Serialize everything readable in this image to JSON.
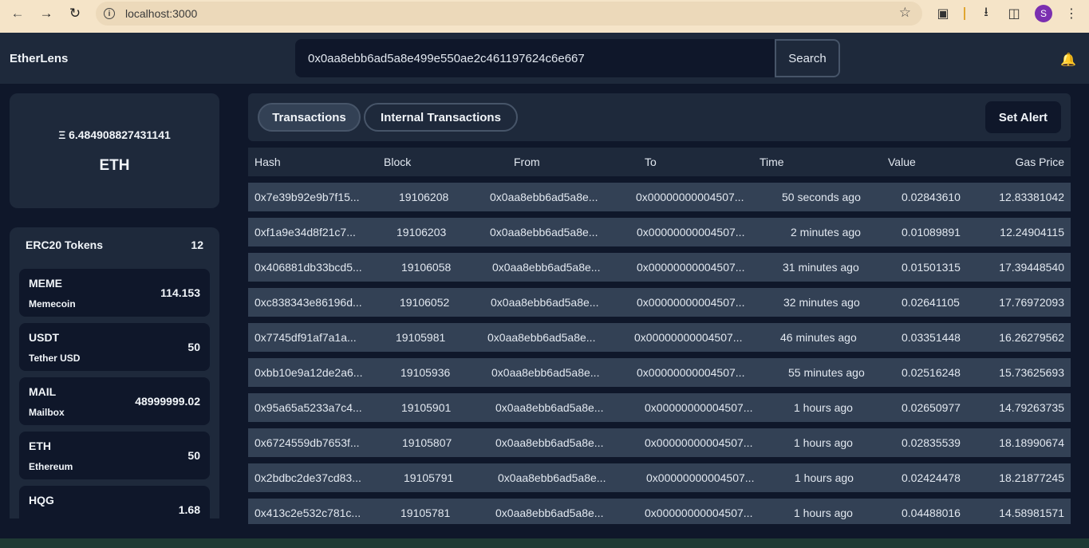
{
  "browser": {
    "url": "localhost:3000",
    "profile_initial": "S"
  },
  "header": {
    "brand": "EtherLens",
    "search_value": "0x0aa8ebb6ad5a8e499e550ae2c461197624c6e667",
    "search_button": "Search"
  },
  "balance": {
    "value": "Ξ 6.484908827431141",
    "unit": "ETH"
  },
  "tokens": {
    "title": "ERC20 Tokens",
    "count": "12",
    "items": [
      {
        "symbol": "MEME",
        "name": "Memecoin",
        "balance": "114.153"
      },
      {
        "symbol": "USDT",
        "name": "Tether USD",
        "balance": "50"
      },
      {
        "symbol": "MAIL",
        "name": "Mailbox",
        "balance": "48999999.02"
      },
      {
        "symbol": "ETH",
        "name": "Ethereum",
        "balance": "50"
      },
      {
        "symbol": "HQG",
        "name": "",
        "balance": "1.68"
      }
    ]
  },
  "tabs": {
    "transactions": "Transactions",
    "internal": "Internal Transactions",
    "set_alert": "Set Alert"
  },
  "table": {
    "columns": [
      "Hash",
      "Block",
      "From",
      "To",
      "Time",
      "Value",
      "Gas Price"
    ],
    "rows": [
      [
        "0x7e39b92e9b7f15...",
        "19106208",
        "0x0aa8ebb6ad5a8e...",
        "0x00000000004507...",
        "50 seconds ago",
        "0.02843610",
        "12.83381042"
      ],
      [
        "0xf1a9e34d8f21c7...",
        "19106203",
        "0x0aa8ebb6ad5a8e...",
        "0x00000000004507...",
        "2 minutes ago",
        "0.01089891",
        "12.24904115"
      ],
      [
        "0x406881db33bcd5...",
        "19106058",
        "0x0aa8ebb6ad5a8e...",
        "0x00000000004507...",
        "31 minutes ago",
        "0.01501315",
        "17.39448540"
      ],
      [
        "0xc838343e86196d...",
        "19106052",
        "0x0aa8ebb6ad5a8e...",
        "0x00000000004507...",
        "32 minutes ago",
        "0.02641105",
        "17.76972093"
      ],
      [
        "0x7745df91af7a1a...",
        "19105981",
        "0x0aa8ebb6ad5a8e...",
        "0x00000000004507...",
        "46 minutes ago",
        "0.03351448",
        "16.26279562"
      ],
      [
        "0xbb10e9a12de2a6...",
        "19105936",
        "0x0aa8ebb6ad5a8e...",
        "0x00000000004507...",
        "55 minutes ago",
        "0.02516248",
        "15.73625693"
      ],
      [
        "0x95a65a5233a7c4...",
        "19105901",
        "0x0aa8ebb6ad5a8e...",
        "0x00000000004507...",
        "1 hours ago",
        "0.02650977",
        "14.79263735"
      ],
      [
        "0x6724559db7653f...",
        "19105807",
        "0x0aa8ebb6ad5a8e...",
        "0x00000000004507...",
        "1 hours ago",
        "0.02835539",
        "18.18990674"
      ],
      [
        "0x2bdbc2de37cd83...",
        "19105791",
        "0x0aa8ebb6ad5a8e...",
        "0x00000000004507...",
        "1 hours ago",
        "0.02424478",
        "18.21877245"
      ],
      [
        "0x413c2e532c781c...",
        "19105781",
        "0x0aa8ebb6ad5a8e...",
        "0x00000000004507...",
        "1 hours ago",
        "0.04488016",
        "14.58981571"
      ]
    ]
  }
}
